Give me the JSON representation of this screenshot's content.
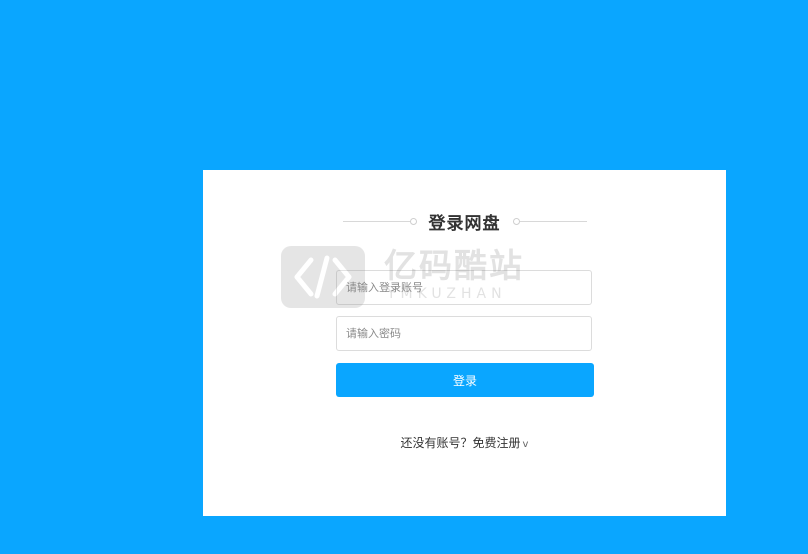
{
  "login": {
    "title": "登录网盘",
    "account_placeholder": "请输入登录账号",
    "password_placeholder": "请输入密码",
    "submit_label": "登录",
    "register_text": "还没有账号？免费注册",
    "register_chevron": "v"
  },
  "watermark": {
    "brand_cn": "亿码酷站",
    "brand_en": "YMKUZHAN"
  },
  "colors": {
    "background": "#0aa6ff",
    "button": "#0aa6ff",
    "card": "#ffffff"
  },
  "icons": {
    "watermark_logo": "code-brackets-icon"
  }
}
